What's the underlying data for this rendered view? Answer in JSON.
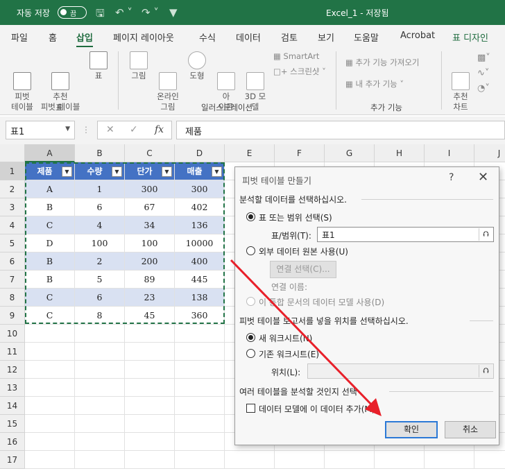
{
  "titlebar": {
    "autosave_label": "자동 저장",
    "autosave_state": "끔",
    "document_title": "Excel_1  -  저장됨"
  },
  "tabs": [
    "파일",
    "홈",
    "삽입",
    "페이지 레이아웃",
    "수식",
    "데이터",
    "검토",
    "보기",
    "도움말",
    "Acrobat",
    "표 디자인"
  ],
  "ribbon": {
    "pivot_table": "피벗\n테이블",
    "recommended_pivot": "추천\n피벗 테이블",
    "table": "표",
    "group_table": "표",
    "pictures": "그림",
    "online_pictures": "온라인\n그림",
    "shapes": "도형",
    "icons": "아\n이콘",
    "models_3d": "3D 모\n델",
    "smartart": "SmartArt",
    "screenshot": "스크린샷",
    "group_illustrations": "일러스트레이션",
    "get_addins": "추가 기능 가져오기",
    "my_addins": "내 추가 기능",
    "group_addins": "추가 기능",
    "recommended_charts": "추천\n차트"
  },
  "formula_bar": {
    "name_box": "표1",
    "cancel": "✕",
    "enter": "✓",
    "fx": "fx",
    "content": "제품"
  },
  "columns": [
    "A",
    "B",
    "C",
    "D",
    "E",
    "F",
    "G",
    "H",
    "I",
    "J"
  ],
  "rows": [
    "1",
    "2",
    "3",
    "4",
    "5",
    "6",
    "7",
    "8",
    "9",
    "10",
    "11",
    "12",
    "13",
    "14",
    "15",
    "16",
    "17"
  ],
  "table": {
    "headers": [
      "제품",
      "수량",
      "단가",
      "매출"
    ],
    "rows": [
      [
        "A",
        "1",
        "300",
        "300"
      ],
      [
        "B",
        "6",
        "67",
        "402"
      ],
      [
        "C",
        "4",
        "34",
        "136"
      ],
      [
        "D",
        "100",
        "100",
        "10000"
      ],
      [
        "B",
        "2",
        "200",
        "400"
      ],
      [
        "B",
        "5",
        "89",
        "445"
      ],
      [
        "C",
        "6",
        "23",
        "138"
      ],
      [
        "C",
        "8",
        "45",
        "360"
      ]
    ]
  },
  "dialog": {
    "title": "피벗 테이블 만들기",
    "help": "?",
    "close": "✕",
    "section_data": "분석할 데이터를 선택하십시오.",
    "opt_table_range": "표 또는 범위 선택(S)",
    "range_label": "표/범위(T):",
    "range_value": "표1",
    "opt_external": "외부 데이터 원본 사용(U)",
    "choose_connection": "연결 선택(C)...",
    "connection_name": "연결 이름:",
    "opt_data_model": "이 통합 문서의 데이터 모델 사용(D)",
    "section_location": "피벗 테이블 보고서를 넣을 위치를 선택하십시오.",
    "opt_new_sheet": "새 워크시트(N)",
    "opt_existing_sheet": "기존 워크시트(E)",
    "location_label": "위치(L):",
    "location_value": "",
    "section_multiple": "여러 테이블을 분석할 것인지 선택",
    "add_to_model": "데이터 모델에 이 데이터 추가(M)",
    "ok": "확인",
    "cancel": "취소"
  },
  "colors": {
    "excel_green": "#217346",
    "table_header": "#4472c4",
    "table_band": "#d9e1f2",
    "annotation_arrow": "#e8202a"
  }
}
